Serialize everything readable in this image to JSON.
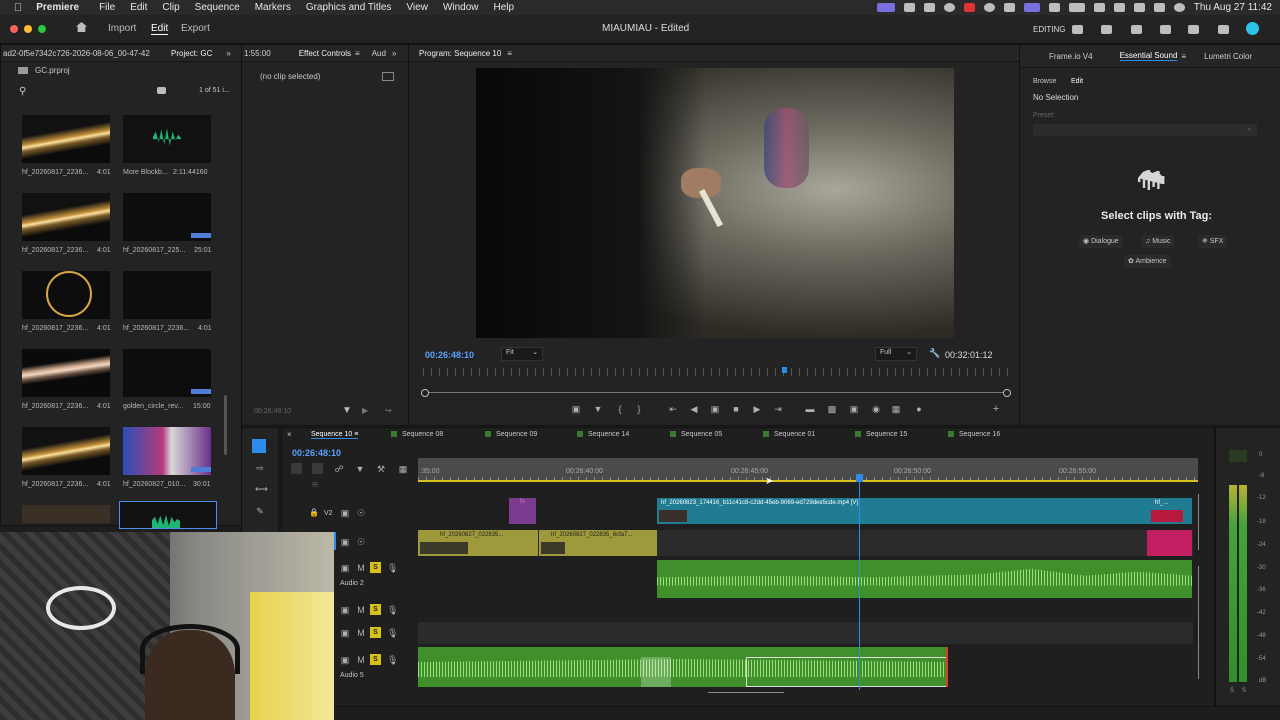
{
  "menubar": {
    "app": "Premiere",
    "items": [
      "File",
      "Edit",
      "Clip",
      "Sequence",
      "Markers",
      "Graphics and Titles",
      "View",
      "Window",
      "Help"
    ],
    "clock": "Thu Aug 27  11:42"
  },
  "appbar": {
    "tabs": [
      "Import",
      "Edit",
      "Export"
    ],
    "title": "MIAUMIAU - Edited",
    "workspace": "EDITING"
  },
  "project": {
    "panel_path": "ad2-0f5e7342c726-2026-08-06_00-47-42",
    "panel_label": "Project: GC",
    "file": "GC.prproj",
    "count": "1 of 51 i...",
    "items": [
      {
        "name": "hf_20260817_2236...",
        "dur": "4:01"
      },
      {
        "name": "More Blockb...",
        "dur": "2:11:44160"
      },
      {
        "name": "hf_20260817_2236...",
        "dur": "4:01"
      },
      {
        "name": "hf_20260817_225...",
        "dur": "25:01"
      },
      {
        "name": "hf_20260817_2236...",
        "dur": "4:01"
      },
      {
        "name": "hf_20260817_2236...",
        "dur": "4:01"
      },
      {
        "name": "hf_20260817_2236...",
        "dur": "4:01"
      },
      {
        "name": "golden_circle_rev...",
        "dur": "15:00"
      },
      {
        "name": "hf_20260817_2236...",
        "dur": "4:01"
      },
      {
        "name": "hf_20260827_010...",
        "dur": "30:01"
      }
    ]
  },
  "effect_controls": {
    "timecode_left": "1:55:00",
    "tab1": "Effect Controls",
    "tab2": "Aud",
    "empty": "(no clip selected)",
    "bottom_tc": "00:26:48:10"
  },
  "program": {
    "title": "Program: Sequence 10",
    "timecode": "00:26:48:10",
    "fit": "Fit",
    "quality": "Full",
    "duration": "00:32:01:12"
  },
  "right_panel": {
    "tabs": [
      "Frame.io V4",
      "Essential Sound",
      "Lumetri Color"
    ],
    "subtabs": [
      "Browse",
      "Edit"
    ],
    "no_selection": "No Selection",
    "preset_label": "Preset:",
    "heading": "Select clips with Tag:",
    "tags": [
      "Dialogue",
      "Music",
      "SFX",
      "Ambience"
    ]
  },
  "timeline": {
    "timecode": "00:26:48:10",
    "tabs": [
      "Sequence 10",
      "Sequence 08",
      "Sequence 09",
      "Sequence 14",
      "Sequence 05",
      "Sequence 01",
      "Sequence 15",
      "Sequence 16"
    ],
    "ticks": [
      ":35:00",
      "00:26:40:00",
      "00:26:45:00",
      "00:26:50:00",
      "00:26:55:00"
    ],
    "v2": "V2",
    "audio2": "Audio 2",
    "audio5": "Audio 5",
    "clips": {
      "main_v": "hf_20260823_174416_b11c41c8-c2dd-45eb-9069-ed729dee5cde.mp4 [V]",
      "y1": "hf_20260827_022835...",
      "y2": "hf_20260827_022835_6cfa7...",
      "fx": "fx",
      "pink": "hf_..."
    },
    "meter": [
      "0",
      "-6",
      "-12",
      "-18",
      "-24",
      "-30",
      "-36",
      "-42",
      "-48",
      "-54",
      "dB"
    ],
    "meter_bottom": [
      "S",
      "S"
    ]
  },
  "colors": {
    "accent_blue": "#2d8ceb",
    "clip_teal": "#1f7c93",
    "clip_yellow": "#9e9a3b",
    "audio_green": "#3f8f2a",
    "solo_yellow": "#d9c11b"
  }
}
